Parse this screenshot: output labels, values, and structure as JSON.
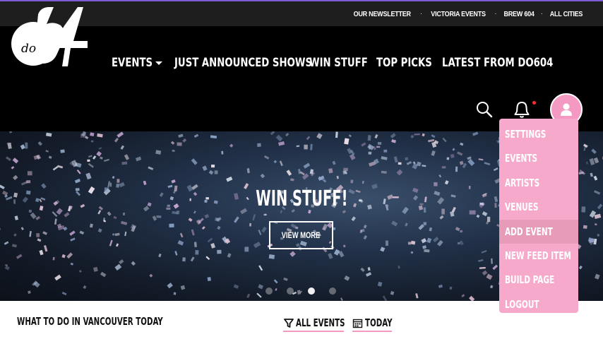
{
  "top_links": [
    "OUR NEWSLETTER",
    "VICTORIA EVENTS",
    "BREW 604",
    "ALL CITIES"
  ],
  "top_separator": "·",
  "logo": {
    "text": "do",
    "number": "604"
  },
  "nav": {
    "events": "EVENTS",
    "just_announced": "JUST ANNOUNCED SHOWS",
    "win_stuff": "WIN STUFF",
    "top_picks": "TOP PICKS",
    "latest": "LATEST FROM DO604"
  },
  "icons": {
    "search": "search-icon",
    "bell": "bell-icon",
    "avatar": "user-icon",
    "filter": "filter-icon",
    "calendar": "calendar-icon"
  },
  "colors": {
    "accent_pink": "#f49ac2",
    "menu_pink": "#f7a9cb",
    "notification": "#ff2d2d",
    "top_strip": "#7b5bd6"
  },
  "hero": {
    "title": "WIN STUFF!",
    "button": "VIEW MORE",
    "slides": 4,
    "active_slide": 3
  },
  "bottom": {
    "heading": "WHAT TO DO IN VANCOUVER TODAY",
    "filter_all": "ALL EVENTS",
    "filter_date": "TODAY"
  },
  "user_menu": {
    "items": [
      "SETTINGS",
      "EVENTS",
      "ARTISTS",
      "VENUES",
      "ADD EVENT",
      "NEW FEED ITEM",
      "BUILD PAGE",
      "LOGOUT"
    ],
    "hovered": "ADD EVENT"
  }
}
